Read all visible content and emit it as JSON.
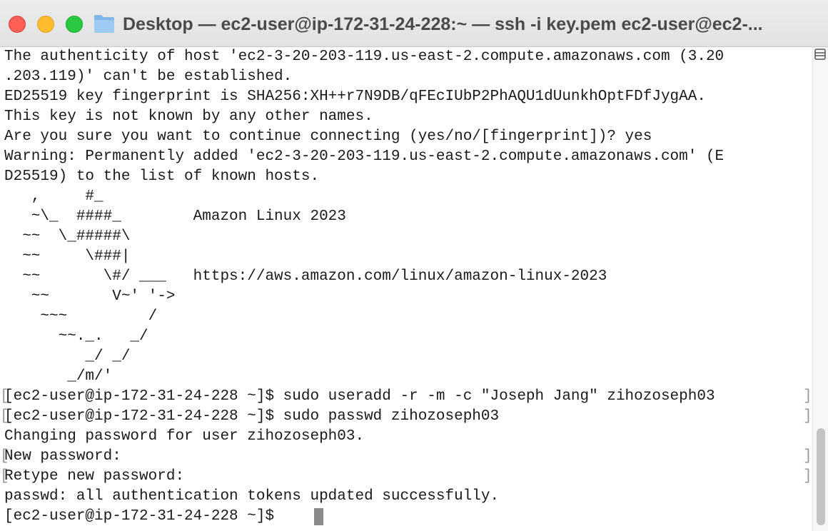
{
  "window": {
    "title": "Desktop — ec2-user@ip-172-31-24-228:~ — ssh -i key.pem ec2-user@ec2-..."
  },
  "icons": {
    "folder": "folder-icon",
    "close": "close-button",
    "minimize": "minimize-button",
    "zoom": "zoom-button",
    "sidebar": "sidebar-icon"
  },
  "colors": {
    "close": "#fe5f57",
    "minimize": "#febc2e",
    "zoom": "#28c840",
    "folder": "#7fb7e8",
    "text": "#1a1a1a"
  },
  "terminal": {
    "lines": [
      "The authenticity of host 'ec2-3-20-203-119.us-east-2.compute.amazonaws.com (3.20",
      ".203.119)' can't be established.",
      "ED25519 key fingerprint is SHA256:XH++r7N9DB/qFEcIUbP2PhAQU1dUunkhOptFDfJygAA.",
      "This key is not known by any other names.",
      "Are you sure you want to continue connecting (yes/no/[fingerprint])? yes",
      "Warning: Permanently added 'ec2-3-20-203-119.us-east-2.compute.amazonaws.com' (E",
      "D25519) to the list of known hosts.",
      "   ,     #_",
      "   ~\\_  ####_        Amazon Linux 2023",
      "  ~~  \\_#####\\",
      "  ~~     \\###|",
      "  ~~       \\#/ ___   https://aws.amazon.com/linux/amazon-linux-2023",
      "   ~~       V~' '->",
      "    ~~~         /",
      "      ~~._.   _/",
      "         _/ _/",
      "       _/m/'",
      "[ec2-user@ip-172-31-24-228 ~]$ sudo useradd -r -m -c \"Joseph Jang\" zihozoseph03",
      "[ec2-user@ip-172-31-24-228 ~]$ sudo passwd zihozoseph03",
      "Changing password for user zihozoseph03.",
      "New password:",
      "Retype new password:",
      "passwd: all authentication tokens updated successfully.",
      "[ec2-user@ip-172-31-24-228 ~]$ "
    ],
    "bracket": "[",
    "bracket_close": "]"
  }
}
